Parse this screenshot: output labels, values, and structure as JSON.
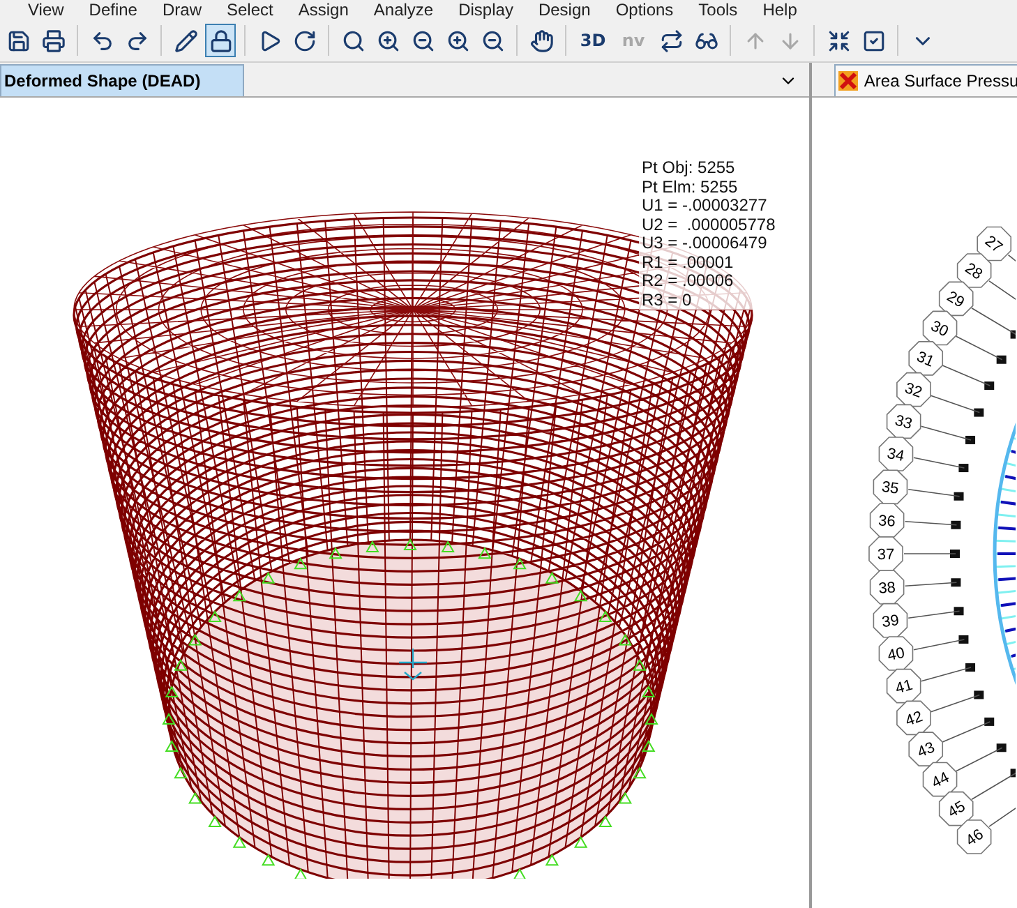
{
  "menu": [
    "View",
    "Define",
    "Draw",
    "Select",
    "Assign",
    "Analyze",
    "Display",
    "Design",
    "Options",
    "Tools",
    "Help"
  ],
  "toolbar": {
    "lock_pressed": true,
    "labels": [
      {
        "text": "3D",
        "disabled": false
      },
      {
        "text": "nv",
        "disabled": true
      }
    ],
    "arrows_disabled": true
  },
  "left_pane": {
    "tab": {
      "label": "Deformed Shape (DEAD)",
      "selected": true
    },
    "readout": [
      "Pt Obj: 5255",
      "Pt Elm: 5255",
      "U1 = -.00003277",
      "U2 =  .000005778",
      "U3 = -.00006479",
      "R1 = .00001",
      "R2 = .00006",
      "R3 = 0"
    ]
  },
  "right_pane": {
    "tab": {
      "label": "Area Surface Pressu",
      "selected": false
    },
    "bubbles": [
      "27",
      "28",
      "29",
      "30",
      "31",
      "32",
      "33",
      "34",
      "35",
      "36",
      "37",
      "38",
      "39",
      "40",
      "41",
      "42",
      "43",
      "44",
      "45",
      "46"
    ]
  }
}
